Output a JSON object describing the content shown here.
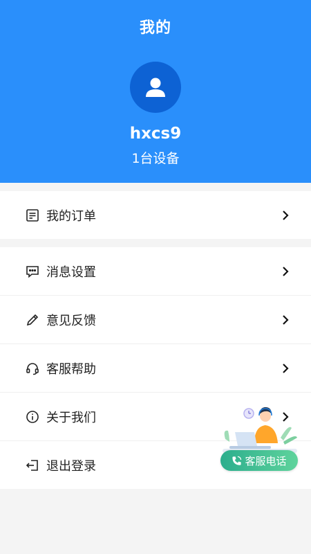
{
  "header": {
    "title": "我的",
    "username": "hxcs9",
    "device_count": "1台设备"
  },
  "menu_group1": [
    {
      "label": "我的订单",
      "icon": "order-list-icon"
    }
  ],
  "menu_group2": [
    {
      "label": "消息设置",
      "icon": "message-icon"
    },
    {
      "label": "意见反馈",
      "icon": "pencil-icon"
    },
    {
      "label": "客服帮助",
      "icon": "headset-icon"
    },
    {
      "label": "关于我们",
      "icon": "info-icon"
    },
    {
      "label": "退出登录",
      "icon": "logout-icon"
    }
  ],
  "floating_service": {
    "label": "客服电话",
    "icon": "phone-icon"
  },
  "colors": {
    "header_bg": "#2a8ffb",
    "avatar_bg": "#0d62d4",
    "service_btn": "#2cae8d"
  }
}
